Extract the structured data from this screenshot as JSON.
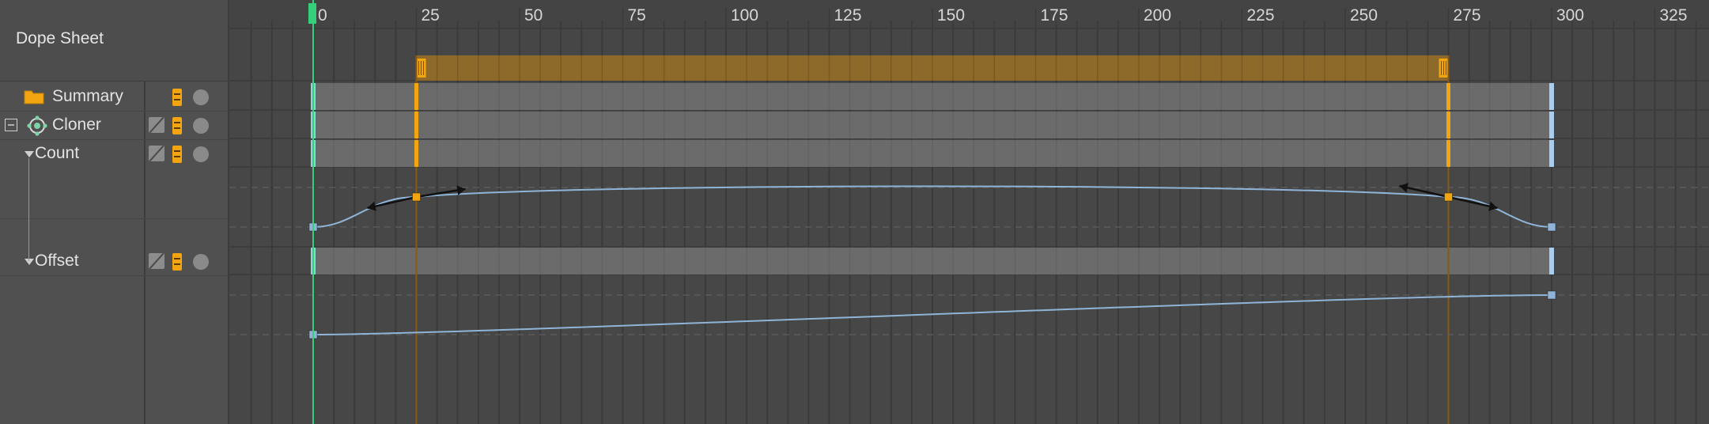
{
  "window": {
    "title": "Dope Sheet"
  },
  "tree": {
    "summary": {
      "label": "Summary"
    },
    "cloner": {
      "label": "Cloner"
    },
    "count": {
      "label": "Count"
    },
    "offset": {
      "label": "Offset"
    }
  },
  "ruler": {
    "frames": [
      0,
      25,
      50,
      75,
      100,
      125,
      150,
      175,
      200,
      225,
      250,
      275,
      300,
      325
    ],
    "labels": [
      "0",
      "25",
      "50",
      "75",
      "100",
      "125",
      "150",
      "175",
      "200",
      "225",
      "250",
      "275",
      "300",
      "325"
    ],
    "current_frame": 0
  },
  "timeline": {
    "range_start_frame": 25,
    "range_end_frame": 275,
    "last_frame": 300,
    "keyframes": {
      "summary": [
        0,
        25,
        275,
        300
      ],
      "cloner": [
        0,
        25,
        275,
        300
      ],
      "count": [
        0,
        25,
        275,
        300
      ],
      "offset": [
        0,
        300
      ]
    }
  },
  "curves": {
    "count": {
      "keys": [
        {
          "frame": 0,
          "value": 0
        },
        {
          "frame": 25,
          "value": 1
        },
        {
          "frame": 275,
          "value": 1
        },
        {
          "frame": 300,
          "value": 0
        }
      ]
    },
    "offset": {
      "keys": [
        {
          "frame": 0,
          "value": 0
        },
        {
          "frame": 300,
          "value": 1
        }
      ]
    }
  },
  "colors": {
    "accent_orange": "#f2a511",
    "playhead_green": "#34d17a",
    "curve_blue": "#8fb4d8",
    "range_bar": "#8e6a2a",
    "track_bg": "#6e6e6e",
    "grid_bg": "#474747"
  },
  "icons": {
    "summary": "folder-icon",
    "cloner": "cloner-icon",
    "expand_collapse": "collapse-icon",
    "disclosure": "triangle-down-icon"
  }
}
